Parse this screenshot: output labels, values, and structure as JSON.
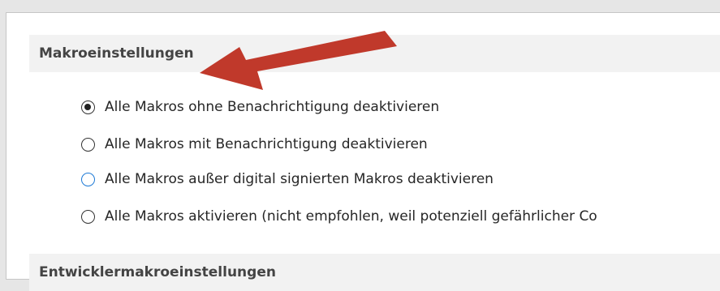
{
  "sections": {
    "macro_settings": {
      "title": "Makroeinstellungen",
      "options": [
        {
          "label": "Alle Makros ohne Benachrichtigung deaktivieren",
          "selected": true,
          "focused": false
        },
        {
          "label": "Alle Makros mit Benachrichtigung deaktivieren",
          "selected": false,
          "focused": false
        },
        {
          "label": "Alle Makros außer digital signierten Makros deaktivieren",
          "selected": false,
          "focused": true
        },
        {
          "label": "Alle Makros aktivieren (nicht empfohlen, weil potenziell gefährlicher Co",
          "selected": false,
          "focused": false
        }
      ]
    },
    "developer_macro_settings": {
      "title": "Entwicklermakroeinstellungen"
    }
  },
  "colors": {
    "annotation_arrow": "#c0392b",
    "focus_ring": "#1e7ad6"
  }
}
